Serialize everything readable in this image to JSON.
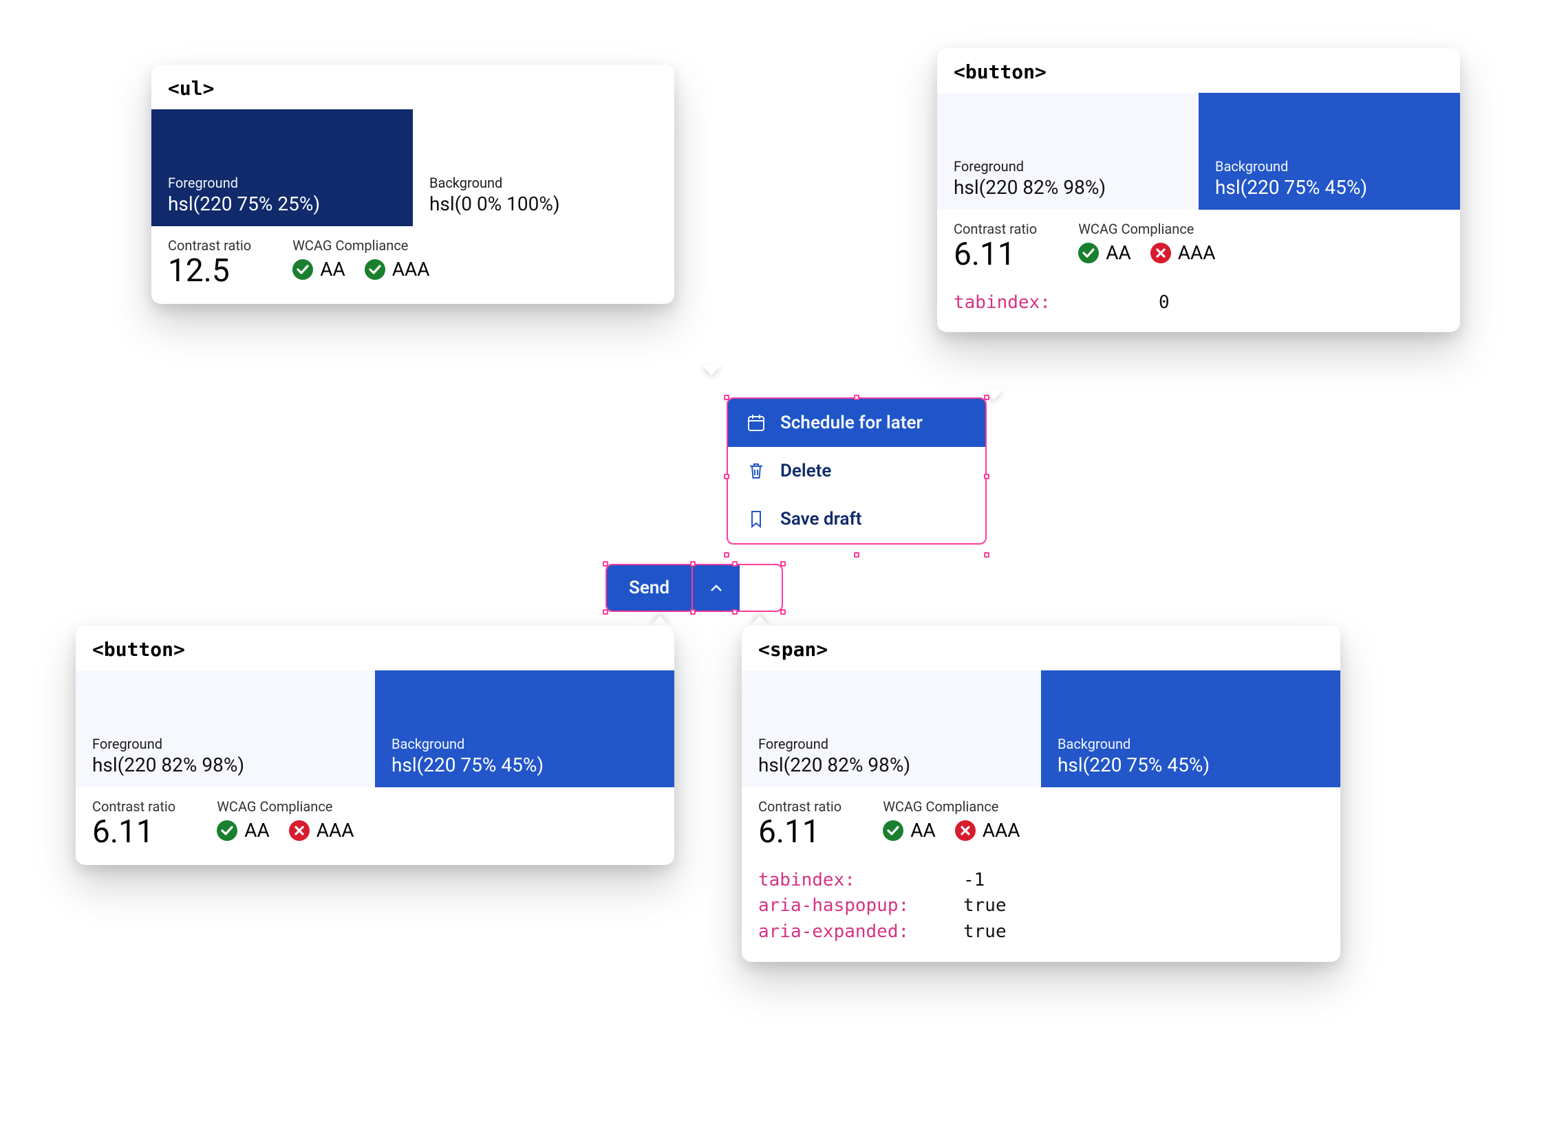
{
  "cards": {
    "ul": {
      "tag": "<ul>",
      "fg_label": "Foreground",
      "fg_value": "hsl(220 75% 25%)",
      "bg_label": "Background",
      "bg_value": "hsl(0 0% 100%)",
      "ratio_label": "Contrast ratio",
      "ratio_value": "12.5",
      "wcag_label": "WCAG Compliance",
      "aa": "AA",
      "aaa": "AAA",
      "aa_pass": true,
      "aaa_pass": true
    },
    "button_tr": {
      "tag": "<button>",
      "fg_label": "Foreground",
      "fg_value": "hsl(220 82% 98%)",
      "bg_label": "Background",
      "bg_value": "hsl(220 75% 45%)",
      "ratio_label": "Contrast ratio",
      "ratio_value": "6.11",
      "wcag_label": "WCAG Compliance",
      "aa": "AA",
      "aaa": "AAA",
      "aa_pass": true,
      "aaa_pass": false,
      "attrs": [
        {
          "k": "tabindex:",
          "v": "0"
        }
      ]
    },
    "button_bl": {
      "tag": "<button>",
      "fg_label": "Foreground",
      "fg_value": "hsl(220 82% 98%)",
      "bg_label": "Background",
      "bg_value": "hsl(220 75% 45%)",
      "ratio_label": "Contrast ratio",
      "ratio_value": "6.11",
      "wcag_label": "WCAG Compliance",
      "aa": "AA",
      "aaa": "AAA",
      "aa_pass": true,
      "aaa_pass": false
    },
    "span_br": {
      "tag": "<span>",
      "fg_label": "Foreground",
      "fg_value": "hsl(220 82% 98%)",
      "bg_label": "Background",
      "bg_value": "hsl(220 75% 45%)",
      "ratio_label": "Contrast ratio",
      "ratio_value": "6.11",
      "wcag_label": "WCAG Compliance",
      "aa": "AA",
      "aaa": "AAA",
      "aa_pass": true,
      "aaa_pass": false,
      "attrs": [
        {
          "k": "tabindex:",
          "v": "-1"
        },
        {
          "k": "aria-haspopup:",
          "v": "true"
        },
        {
          "k": "aria-expanded:",
          "v": "true"
        }
      ]
    }
  },
  "dropdown": {
    "items": [
      {
        "label": "Schedule for later",
        "icon": "calendar"
      },
      {
        "label": "Delete",
        "icon": "trash"
      },
      {
        "label": "Save draft",
        "icon": "bookmark"
      }
    ]
  },
  "sendbar": {
    "send_label": "Send"
  },
  "colors": {
    "fg_dark": "hsl(220 75% 25%)",
    "bg_white": "hsl(0 0% 100%)",
    "fg_light": "hsl(220 82% 98%)",
    "bg_blue": "hsl(220 75% 45%)",
    "select_pink": "#ff3b9a"
  }
}
